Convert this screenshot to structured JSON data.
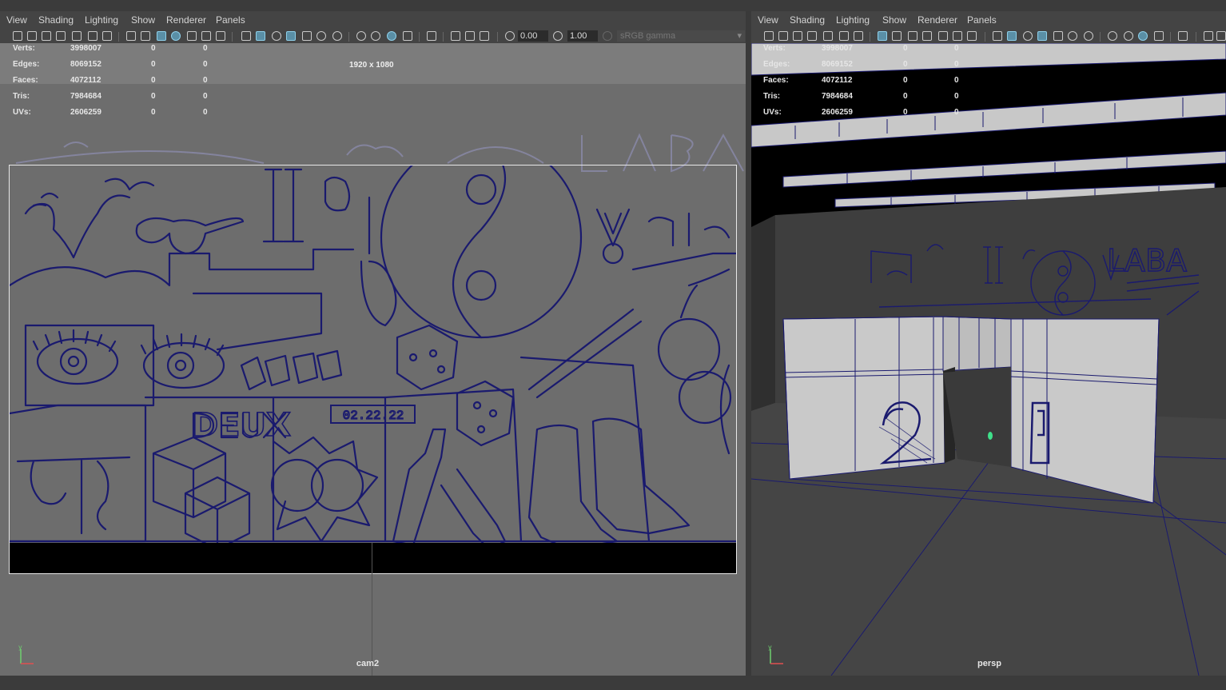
{
  "menus": [
    "View",
    "Shading",
    "Lighting",
    "Show",
    "Renderer",
    "Panels"
  ],
  "left_panel": {
    "exposure": "0.00",
    "gamma": "1.00",
    "color_space": "sRGB gamma",
    "resolution": "1920 x 1080",
    "camera": "cam2",
    "mural_date": "02.22.22",
    "mural_word": "DEUX"
  },
  "right_panel": {
    "camera": "persp",
    "laba_text": "LABA"
  },
  "hud": {
    "rows": [
      {
        "label": "Verts:",
        "v1": "3998007",
        "v2": "0",
        "v3": "0"
      },
      {
        "label": "Edges:",
        "v1": "8069152",
        "v2": "0",
        "v3": "0"
      },
      {
        "label": "Faces:",
        "v1": "4072112",
        "v2": "0",
        "v3": "0"
      },
      {
        "label": "Tris:",
        "v1": "7984684",
        "v2": "0",
        "v3": "0"
      },
      {
        "label": "UVs:",
        "v1": "2606259",
        "v2": "0",
        "v3": "0"
      }
    ]
  },
  "colors": {
    "wireframe": "#1a1a6e",
    "active_icon": "#5a8fa6",
    "viewport_grey": "#7c7c7c",
    "background": "#444444"
  },
  "icons": [
    "camera-icon",
    "grid-icon",
    "wireframe-shading-icon",
    "smooth-shading-icon",
    "light-icon",
    "xray-icon",
    "isolate-icon",
    "exposure-icon",
    "gamma-icon",
    "axis-gizmo-icon"
  ]
}
